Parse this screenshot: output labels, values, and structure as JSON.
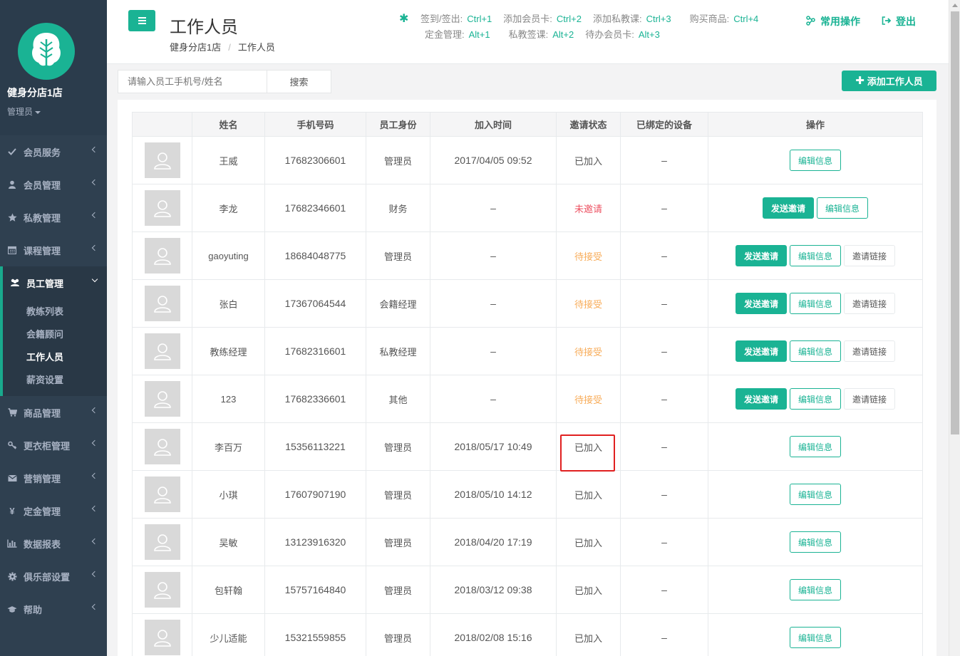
{
  "sidebar": {
    "shop_name": "健身分店1店",
    "role": "管理员",
    "items": [
      {
        "label": "会员服务",
        "icon": "check-icon"
      },
      {
        "label": "会员管理",
        "icon": "user-icon"
      },
      {
        "label": "私教管理",
        "icon": "star-icon"
      },
      {
        "label": "课程管理",
        "icon": "calendar-icon"
      },
      {
        "label": "员工管理",
        "icon": "users-icon"
      },
      {
        "label": "商品管理",
        "icon": "cart-icon"
      },
      {
        "label": "更衣柜管理",
        "icon": "key-icon"
      },
      {
        "label": "营销管理",
        "icon": "envelope-icon"
      },
      {
        "label": "定金管理",
        "icon": "yen-icon"
      },
      {
        "label": "数据报表",
        "icon": "bar-chart-icon"
      },
      {
        "label": "俱乐部设置",
        "icon": "gear-icon"
      },
      {
        "label": "帮助",
        "icon": "graduation-cap-icon"
      }
    ],
    "sub_items": [
      "教练列表",
      "会籍顾问",
      "工作人员",
      "薪资设置"
    ]
  },
  "header": {
    "title": "工作人员",
    "breadcrumb": [
      "健身分店1店",
      "工作人员"
    ],
    "shortcuts_row1": [
      {
        "label": "签到/签出:",
        "key": "Ctrl+1"
      },
      {
        "label": "添加会员卡:",
        "key": "Ctrl+2"
      },
      {
        "label": "添加私教课:",
        "key": "Ctrl+3"
      },
      {
        "label": "购买商品:",
        "key": "Ctrl+4"
      }
    ],
    "shortcuts_row2": [
      {
        "label": "定金管理:",
        "key": "Alt+1"
      },
      {
        "label": "私教签课:",
        "key": "Alt+2"
      },
      {
        "label": "待办会员卡:",
        "key": "Alt+3"
      }
    ],
    "common_ops": "常用操作",
    "logout": "登出"
  },
  "search": {
    "placeholder": "请输入员工手机号/姓名",
    "button": "搜索"
  },
  "add_button": "添加工作人员",
  "table": {
    "columns": [
      "",
      "姓名",
      "手机号码",
      "员工身份",
      "加入时间",
      "邀请状态",
      "已绑定的设备",
      "操作"
    ],
    "rows": [
      {
        "name": "王威",
        "phone": "17682306601",
        "role": "管理员",
        "joined": "2017/04/05 09:52",
        "status": "已加入",
        "device": "–"
      },
      {
        "name": "李龙",
        "phone": "17682346601",
        "role": "财务",
        "joined": "–",
        "status": "未邀请",
        "device": "–"
      },
      {
        "name": "gaoyuting",
        "phone": "18684048775",
        "role": "管理员",
        "joined": "–",
        "status": "待接受",
        "device": "–"
      },
      {
        "name": "张白",
        "phone": "17367064544",
        "role": "会籍经理",
        "joined": "–",
        "status": "待接受",
        "device": "–"
      },
      {
        "name": "教练经理",
        "phone": "17682316601",
        "role": "私教经理",
        "joined": "–",
        "status": "待接受",
        "device": "–"
      },
      {
        "name": "123",
        "phone": "17682336601",
        "role": "其他",
        "joined": "–",
        "status": "待接受",
        "device": "–"
      },
      {
        "name": "李百万",
        "phone": "15356113221",
        "role": "管理员",
        "joined": "2018/05/17 10:49",
        "status": "已加入",
        "device": "–"
      },
      {
        "name": "小琪",
        "phone": "17607907190",
        "role": "管理员",
        "joined": "2018/05/10 14:12",
        "status": "已加入",
        "device": "–"
      },
      {
        "name": "吴敏",
        "phone": "13123916320",
        "role": "管理员",
        "joined": "2018/04/20 17:19",
        "status": "已加入",
        "device": "–"
      },
      {
        "name": "包轩翰",
        "phone": "15757164840",
        "role": "管理员",
        "joined": "2018/03/12 09:38",
        "status": "已加入",
        "device": "–"
      },
      {
        "name": "少儿适能",
        "phone": "15321559855",
        "role": "管理员",
        "joined": "2018/02/08 15:16",
        "status": "已加入",
        "device": "–"
      }
    ],
    "actions": {
      "send": "发送邀请",
      "edit": "编辑信息",
      "link": "邀请链接"
    }
  },
  "colors": {
    "accent": "#1ab394",
    "sidebar_bg": "#2f4050",
    "not_invited": "#ed5565",
    "pending": "#f8ac59",
    "highlight": "#e02020"
  }
}
